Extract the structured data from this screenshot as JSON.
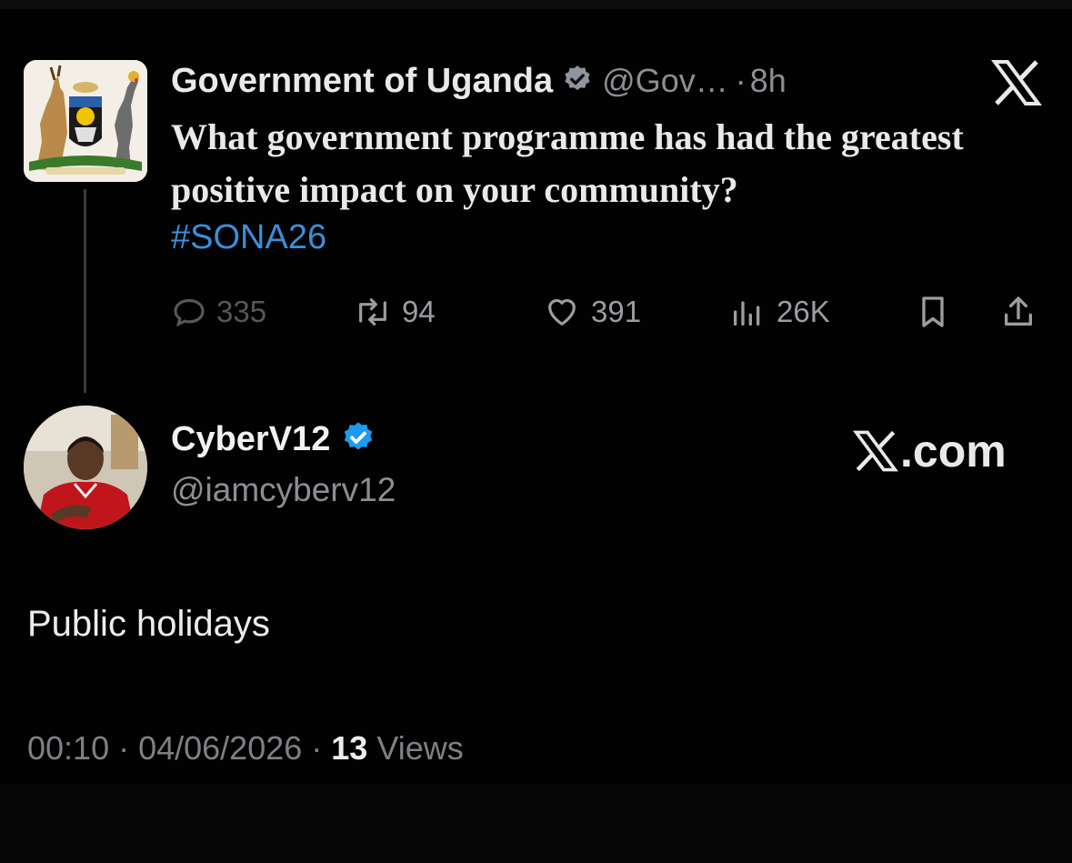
{
  "parent_tweet": {
    "author_name": "Government of Uganda",
    "handle": "@Gov…",
    "separator": "·",
    "time": "8h",
    "text": "What government programme has had the greatest positive impact on your community?",
    "hashtag": "#SONA26",
    "counts": {
      "replies": "335",
      "reposts": "94",
      "likes": "391",
      "views": "26K"
    }
  },
  "reply_tweet": {
    "author_name": "CyberV12",
    "handle": "@iamcyberv12",
    "brand": ".com",
    "body": "Public holidays",
    "time": "00:10",
    "sep1": " · ",
    "date": "04/06/2026",
    "sep2": " · ",
    "views_count": "13",
    "views_label": " Views"
  },
  "colors": {
    "background": "#000000",
    "accent_blue": "#3b8fd9",
    "verified_badge": "#1d9bf0",
    "muted": "#8b8f93"
  },
  "icons": [
    "coat-of-arms",
    "verified-badge-icon",
    "x-logo-icon",
    "reply-icon",
    "repost-icon",
    "like-icon",
    "views-icon",
    "bookmark-icon",
    "share-icon"
  ]
}
